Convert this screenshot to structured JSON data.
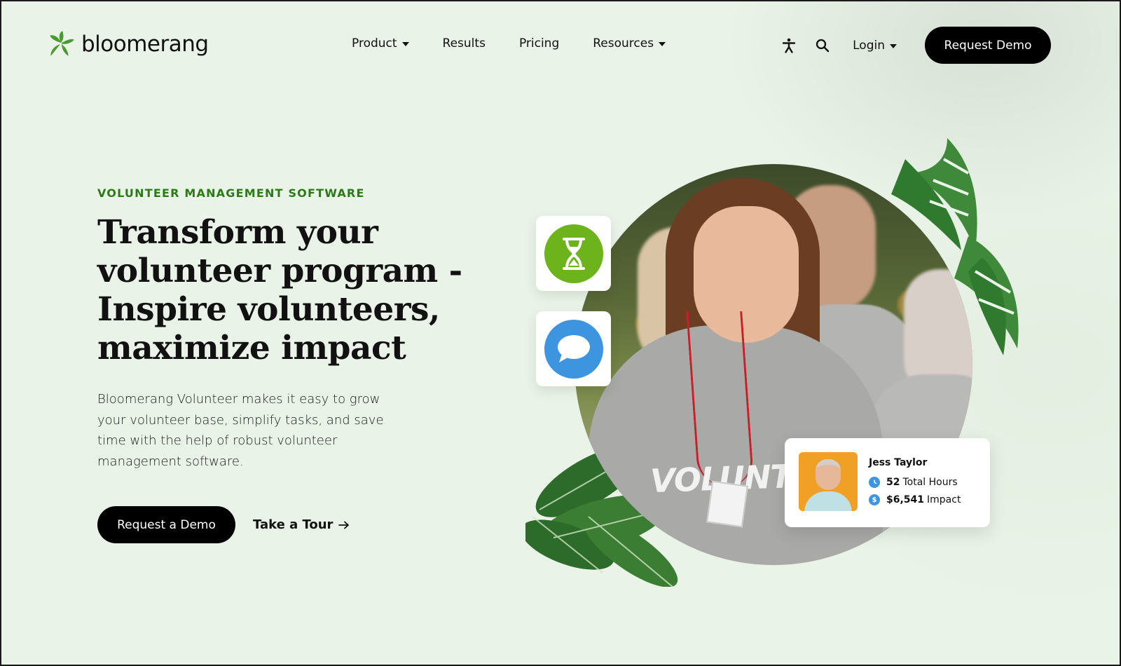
{
  "brand": {
    "name": "bloomerang",
    "logo_icon": "bloomerang-star-icon",
    "brand_green": "#4a9a2f"
  },
  "nav": {
    "items": [
      {
        "label": "Product",
        "has_dropdown": true
      },
      {
        "label": "Results",
        "has_dropdown": false
      },
      {
        "label": "Pricing",
        "has_dropdown": false
      },
      {
        "label": "Resources",
        "has_dropdown": true
      }
    ],
    "accessibility_icon": "accessibility-icon",
    "search_icon": "search-icon",
    "login_label": "Login",
    "request_demo_label": "Request Demo"
  },
  "hero": {
    "eyebrow": "VOLUNTEER MANAGEMENT SOFTWARE",
    "headline_lines": [
      "Transform your",
      "volunteer program -",
      "Inspire volunteers,",
      "maximize impact"
    ],
    "body_lines": [
      "Bloomerang Volunteer makes it easy to grow",
      "your volunteer base, simplify tasks, and save",
      "time with the help of robust volunteer",
      "management software."
    ],
    "primary_cta": "Request a Demo",
    "secondary_cta": "Take a Tour",
    "secondary_cta_icon": "arrow-right-icon",
    "eyebrow_color": "#2b7a17"
  },
  "visual": {
    "shirt_text": "VOLUNTEER",
    "tiles": [
      {
        "icon": "hourglass-icon",
        "color": "#6cb31c"
      },
      {
        "icon": "chat-bubble-icon",
        "color": "#3d95e0"
      }
    ],
    "profile_card": {
      "name": "Jess Taylor",
      "hours_value": "52",
      "hours_label": "Total Hours",
      "impact_value": "$6,541",
      "impact_label": "Impact",
      "hours_icon": "clock-icon",
      "impact_icon": "dollar-icon"
    }
  }
}
